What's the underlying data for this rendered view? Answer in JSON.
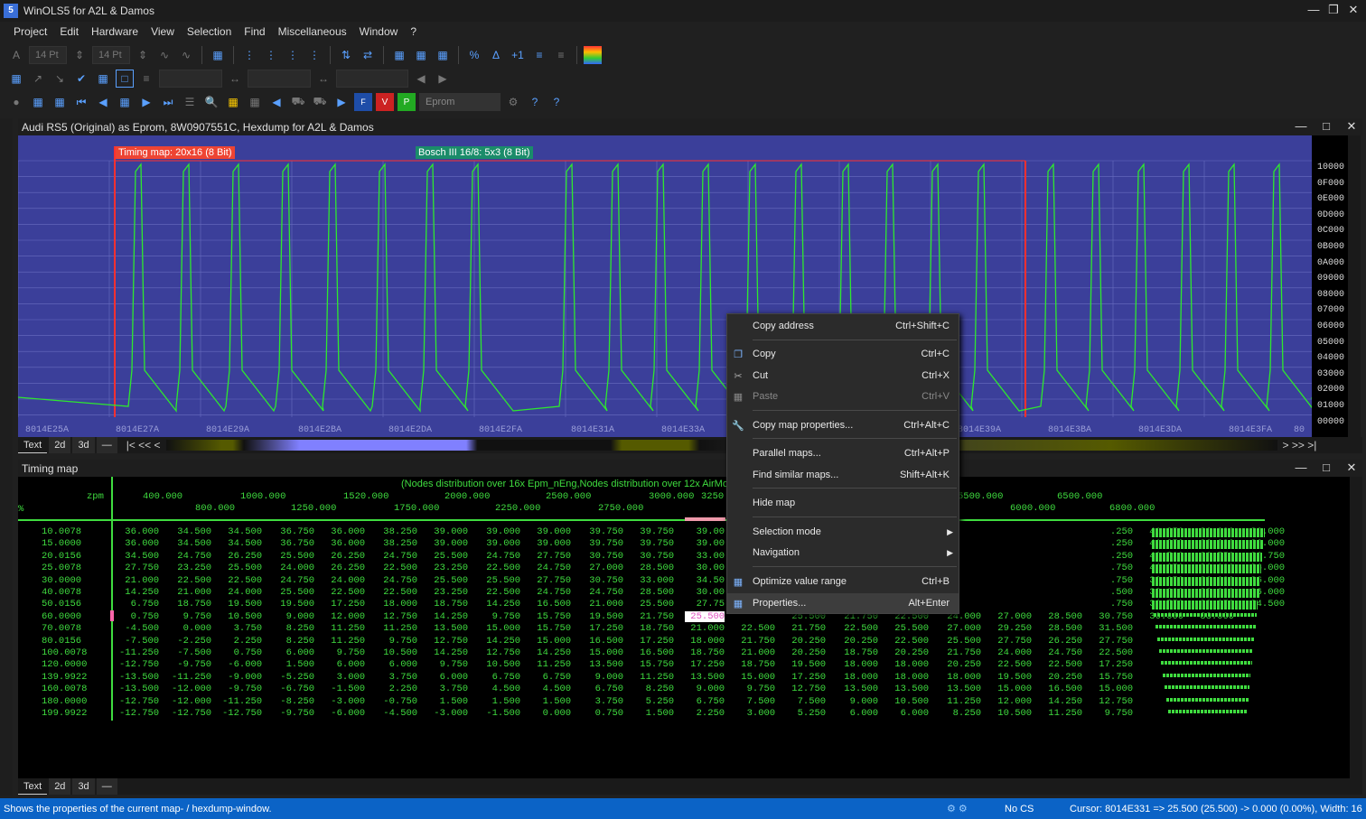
{
  "app": {
    "title": "WinOLS5 for A2L & Damos"
  },
  "menu": [
    "Project",
    "Edit",
    "Hardware",
    "View",
    "Selection",
    "Find",
    "Miscellaneous",
    "Window",
    "?"
  ],
  "toolbar": {
    "font_size_1": "14 Pt",
    "font_size_2": "14 Pt",
    "eprom_field": "Eprom"
  },
  "hexwin": {
    "title": "Audi RS5 (Original) as Eprom, 8W0907551C, Hexdump for A2L & Damos",
    "map_label_1": "Timing map: 20x16 (8 Bit)",
    "map_label_2": "Bosch III 16/8: 5x3 (8 Bit)",
    "y_labels": [
      "10000",
      "0F000",
      "0E000",
      "0D000",
      "0C000",
      "0B000",
      "0A000",
      "09000",
      "08000",
      "07000",
      "06000",
      "05000",
      "04000",
      "03000",
      "02000",
      "01000",
      "00000"
    ],
    "x_labels": [
      "8014E25A",
      "8014E27A",
      "8014E29A",
      "8014E2BA",
      "8014E2DA",
      "8014E2FA",
      "8014E31A",
      "8014E33A",
      "8014E39A",
      "8014E3BA",
      "8014E3DA",
      "8014E3FA",
      "80"
    ],
    "tabs": [
      "Text",
      "2d",
      "3d",
      "—"
    ],
    "colors": {
      "bg": "#3b3f9a",
      "line": "#2ee82e",
      "marker": "#ff3030"
    }
  },
  "mapwin": {
    "title": "Timing map",
    "caption": "(Nodes distribution over 16x Epm_nEng,Nodes distribution over 12x AirMo",
    "x_unit": "zpm",
    "y_unit": "%",
    "x_top": [
      "400.000",
      "1000.000",
      "1520.000",
      "2000.000",
      "2500.000",
      "3000.000",
      "3250",
      "5500.000",
      "6500.000"
    ],
    "x_bottom": [
      "800.000",
      "1250.000",
      "1750.000",
      "2250.000",
      "2750.000",
      "6000.000",
      "6800.000"
    ],
    "y_axis": [
      "10.0078",
      "15.0000",
      "20.0156",
      "25.0078",
      "30.0000",
      "40.0078",
      "50.0156",
      "60.0000",
      "70.0078",
      "80.0156",
      "100.0078",
      "120.0000",
      "139.9922",
      "160.0078",
      "180.0000",
      "199.9922"
    ],
    "left_cols": [
      [
        "36.000",
        "34.500",
        "34.500",
        "36.750",
        "36.000",
        "38.250",
        "39.000",
        "39.000",
        "39.000",
        "39.750",
        "39.750",
        "39.00"
      ],
      [
        "36.000",
        "34.500",
        "34.500",
        "36.750",
        "36.000",
        "38.250",
        "39.000",
        "39.000",
        "39.000",
        "39.750",
        "39.750",
        "39.00"
      ],
      [
        "34.500",
        "24.750",
        "26.250",
        "25.500",
        "26.250",
        "24.750",
        "25.500",
        "24.750",
        "27.750",
        "30.750",
        "30.750",
        "33.00"
      ],
      [
        "27.750",
        "23.250",
        "25.500",
        "24.000",
        "26.250",
        "22.500",
        "23.250",
        "22.500",
        "24.750",
        "27.000",
        "28.500",
        "30.00"
      ],
      [
        "21.000",
        "22.500",
        "22.500",
        "24.750",
        "24.000",
        "24.750",
        "25.500",
        "25.500",
        "27.750",
        "30.750",
        "33.000",
        "34.50"
      ],
      [
        "14.250",
        "21.000",
        "24.000",
        "25.500",
        "22.500",
        "22.500",
        "23.250",
        "22.500",
        "24.750",
        "24.750",
        "28.500",
        "30.00"
      ],
      [
        "6.750",
        "18.750",
        "19.500",
        "19.500",
        "17.250",
        "18.000",
        "18.750",
        "14.250",
        "16.500",
        "21.000",
        "25.500",
        "27.75"
      ],
      [
        "0.750",
        "9.750",
        "10.500",
        "9.000",
        "12.000",
        "12.750",
        "14.250",
        "9.750",
        "15.750",
        "19.500",
        "21.750",
        "25.500"
      ],
      [
        "-4.500",
        "0.000",
        "3.750",
        "8.250",
        "11.250",
        "11.250",
        "13.500",
        "15.000",
        "15.750",
        "17.250",
        "18.750",
        "21.000"
      ],
      [
        "-7.500",
        "-2.250",
        "2.250",
        "8.250",
        "11.250",
        "9.750",
        "12.750",
        "14.250",
        "15.000",
        "16.500",
        "17.250",
        "18.000"
      ],
      [
        "-11.250",
        "-7.500",
        "0.750",
        "6.000",
        "9.750",
        "10.500",
        "14.250",
        "12.750",
        "14.250",
        "15.000",
        "16.500",
        "18.750"
      ],
      [
        "-12.750",
        "-9.750",
        "-6.000",
        "1.500",
        "6.000",
        "6.000",
        "9.750",
        "10.500",
        "11.250",
        "13.500",
        "15.750",
        "17.250"
      ],
      [
        "-13.500",
        "-11.250",
        "-9.000",
        "-5.250",
        "3.000",
        "3.750",
        "6.000",
        "6.750",
        "6.750",
        "9.000",
        "11.250",
        "13.500"
      ],
      [
        "-13.500",
        "-12.000",
        "-9.750",
        "-6.750",
        "-1.500",
        "2.250",
        "3.750",
        "4.500",
        "4.500",
        "6.750",
        "8.250",
        "9.000"
      ],
      [
        "-12.750",
        "-12.000",
        "-11.250",
        "-8.250",
        "-3.000",
        "-0.750",
        "1.500",
        "1.500",
        "1.500",
        "3.750",
        "5.250",
        "6.750"
      ],
      [
        "-12.750",
        "-12.750",
        "-12.750",
        "-9.750",
        "-6.000",
        "-4.500",
        "-3.000",
        "-1.500",
        "0.000",
        "0.750",
        "1.500",
        "2.250"
      ]
    ],
    "right_cols": [
      [
        "",
        "",
        "",
        "",
        "",
        "",
        "",
        ".250",
        "41.250",
        "36.000",
        "36.000"
      ],
      [
        "",
        "",
        "",
        "",
        "",
        "",
        "",
        ".250",
        "41.250",
        "36.000",
        "36.000"
      ],
      [
        "",
        "",
        "",
        "",
        "",
        "",
        "",
        ".250",
        "40.500",
        "36.750",
        "36.750"
      ],
      [
        "",
        "",
        "",
        "",
        "",
        "",
        "",
        ".750",
        "41.250",
        "36.000",
        "36.000"
      ],
      [
        "",
        "",
        "",
        "",
        "",
        "",
        "",
        ".750",
        "38.250",
        "36.000",
        "36.000"
      ],
      [
        "",
        "",
        "",
        "",
        "",
        "",
        "",
        ".500",
        "33.000",
        "33.000",
        "36.000"
      ],
      [
        "",
        "",
        "",
        "",
        "",
        "",
        "",
        ".750",
        "30.750",
        "29.250",
        "34.500"
      ],
      [
        "",
        "25.500",
        "21.750",
        "22.500",
        "24.000",
        "27.000",
        "28.500",
        "30.750",
        "30.000",
        "33.000",
        ""
      ],
      [
        "22.500",
        "21.750",
        "22.500",
        "25.500",
        "27.000",
        "29.250",
        "28.500",
        "31.500",
        "",
        "",
        ""
      ],
      [
        "21.750",
        "20.250",
        "20.250",
        "22.500",
        "25.500",
        "27.750",
        "26.250",
        "27.750",
        "",
        "",
        ""
      ],
      [
        "21.000",
        "20.250",
        "18.750",
        "20.250",
        "21.750",
        "24.000",
        "24.750",
        "22.500",
        "",
        "",
        ""
      ],
      [
        "18.750",
        "19.500",
        "18.000",
        "18.000",
        "20.250",
        "22.500",
        "22.500",
        "17.250",
        "",
        "",
        ""
      ],
      [
        "15.000",
        "17.250",
        "18.000",
        "18.000",
        "18.000",
        "19.500",
        "20.250",
        "15.750",
        "",
        "",
        ""
      ],
      [
        "9.750",
        "12.750",
        "13.500",
        "13.500",
        "13.500",
        "15.000",
        "16.500",
        "15.000",
        "",
        "",
        ""
      ],
      [
        "7.500",
        "7.500",
        "9.000",
        "10.500",
        "11.250",
        "12.000",
        "14.250",
        "12.750",
        "",
        "",
        ""
      ],
      [
        "3.000",
        "5.250",
        "6.000",
        "6.000",
        "8.250",
        "10.500",
        "11.250",
        "9.750",
        "",
        "",
        ""
      ]
    ],
    "selected_cell": "25.500",
    "tabs": [
      "Text",
      "2d",
      "3d",
      "—"
    ]
  },
  "context_menu": {
    "items": [
      {
        "label": "Copy address",
        "shortcut": "Ctrl+Shift+C",
        "icon": ""
      },
      {
        "label": "Copy",
        "shortcut": "Ctrl+C",
        "icon": "copy-icon"
      },
      {
        "label": "Cut",
        "shortcut": "Ctrl+X",
        "icon": "scissors-icon"
      },
      {
        "label": "Paste",
        "shortcut": "Ctrl+V",
        "icon": "paste-icon"
      },
      {
        "label": "Copy map properties...",
        "shortcut": "Ctrl+Alt+C",
        "icon": "wrench-icon"
      },
      {
        "label": "Parallel maps...",
        "shortcut": "Ctrl+Alt+P",
        "icon": ""
      },
      {
        "label": "Find similar maps...",
        "shortcut": "Shift+Alt+K",
        "icon": ""
      },
      {
        "label": "Hide map",
        "shortcut": "",
        "icon": ""
      },
      {
        "label": "Selection mode",
        "shortcut": "",
        "icon": ""
      },
      {
        "label": "Navigation",
        "shortcut": "",
        "icon": ""
      },
      {
        "label": "Optimize value range",
        "shortcut": "Ctrl+B",
        "icon": "optimize-icon"
      },
      {
        "label": "Properties...",
        "shortcut": "Alt+Enter",
        "icon": "properties-icon"
      }
    ]
  },
  "status": {
    "hint": "Shows the properties of the current map- / hexdump-window.",
    "cs": "No CS",
    "cursor": "Cursor: 8014E331 => 25.500 (25.500) -> 0.000 (0.00%), Width: 16"
  }
}
